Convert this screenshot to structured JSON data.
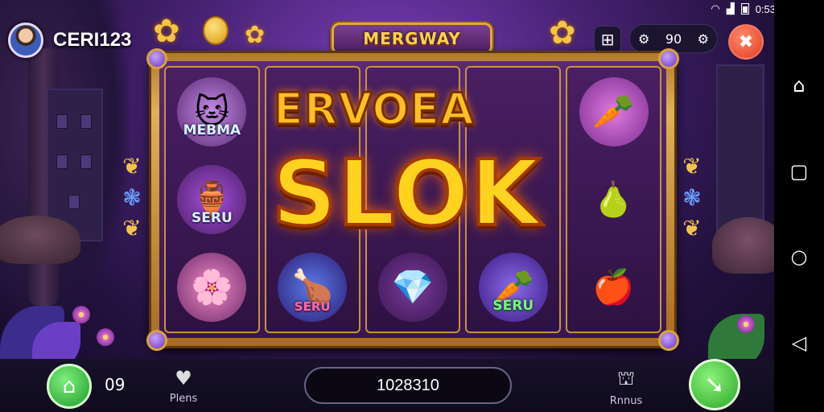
{
  "player": {
    "username": "CERI123"
  },
  "header": {
    "game_title": "MERGWAY"
  },
  "top_controls": {
    "settings_value": "90"
  },
  "reels": {
    "banner_top": "ERVOEA",
    "banner_main": "SLOK",
    "symbols": [
      {
        "caption": "MEBMA",
        "glyph": "🐱",
        "bg": "#c58be6"
      },
      {
        "caption": "SERU",
        "glyph": "🏺",
        "bg": "#8e36c4"
      },
      {
        "caption": "",
        "glyph": "🌸",
        "bg": "#d35fa8"
      },
      {
        "caption": "SERU",
        "glyph": "🦴",
        "bg": "#3e5cc9"
      },
      {
        "caption": "",
        "glyph": "💎",
        "bg": "#6a2a88"
      },
      {
        "caption": "SERU",
        "glyph": "🥕",
        "bg": "#6b2fbf"
      },
      {
        "caption": "",
        "glyph": "🥕",
        "bg": "#b34fc0"
      },
      {
        "caption": "",
        "glyph": "🍐",
        "bg": "#4a1f63"
      },
      {
        "caption": "",
        "glyph": "🍎",
        "bg": "#4a1f63"
      }
    ]
  },
  "bottom": {
    "level": "09",
    "plays_label": "Plens",
    "balance": "1028310",
    "bonus_label": "Rnnus"
  },
  "status_bar": {
    "time": "0:53"
  },
  "colors": {
    "accent_gold": "#e3a93b",
    "home_green": "#1f9a2a",
    "close_red": "#e23a24"
  }
}
